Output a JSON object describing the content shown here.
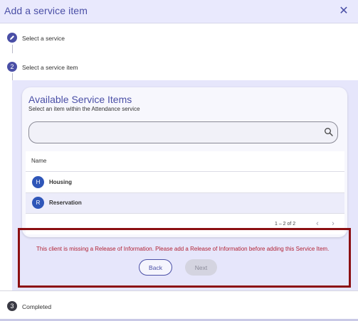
{
  "dialog": {
    "title": "Add a service item",
    "close_icon": "close-icon"
  },
  "steps": [
    {
      "number": "",
      "icon": "pencil-icon",
      "label": "Select a service"
    },
    {
      "number": "2",
      "label": "Select a service item"
    },
    {
      "number": "3",
      "label": "Completed"
    }
  ],
  "card": {
    "title": "Available Service Items",
    "subtitle": "Select an item within the Attendance service",
    "search_value": "",
    "search_icon": "search-icon"
  },
  "table": {
    "column_header": "Name",
    "rows": [
      {
        "initial": "H",
        "label": "Housing"
      },
      {
        "initial": "R",
        "label": "Reservation"
      }
    ],
    "pagination": "1 – 2 of 2",
    "prev_icon": "chevron-left-icon",
    "next_icon": "chevron-right-icon"
  },
  "error_message": "This client is missing a Release of Information. Please add a Release of Information before adding this Service Item.",
  "buttons": {
    "back": "Back",
    "next": "Next"
  },
  "colors": {
    "accent": "#4a4fa6",
    "error": "#b22234",
    "highlight": "#8c0f12",
    "avatar": "#2f56b8"
  }
}
